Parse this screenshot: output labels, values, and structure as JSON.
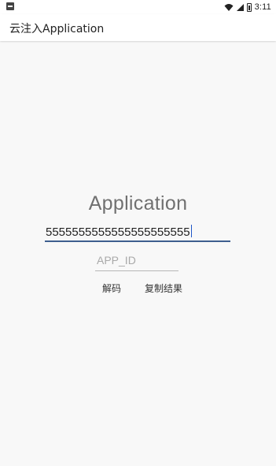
{
  "status_bar": {
    "time": "3:11",
    "icons": [
      "notification-icon",
      "wifi-icon",
      "signal-icon",
      "battery-icon"
    ]
  },
  "app_bar": {
    "title": "云注入Application"
  },
  "main": {
    "heading": "Application",
    "main_input": {
      "value": "5555555555555555555555"
    },
    "app_id_input": {
      "placeholder": "APP_ID"
    },
    "buttons": {
      "decode": "解码",
      "copy_result": "复制结果"
    }
  },
  "colors": {
    "background": "#f8f8f8",
    "app_bar": "#ffffff",
    "accent_underline": "#3f5f8f",
    "caret": "#1f56c8"
  }
}
